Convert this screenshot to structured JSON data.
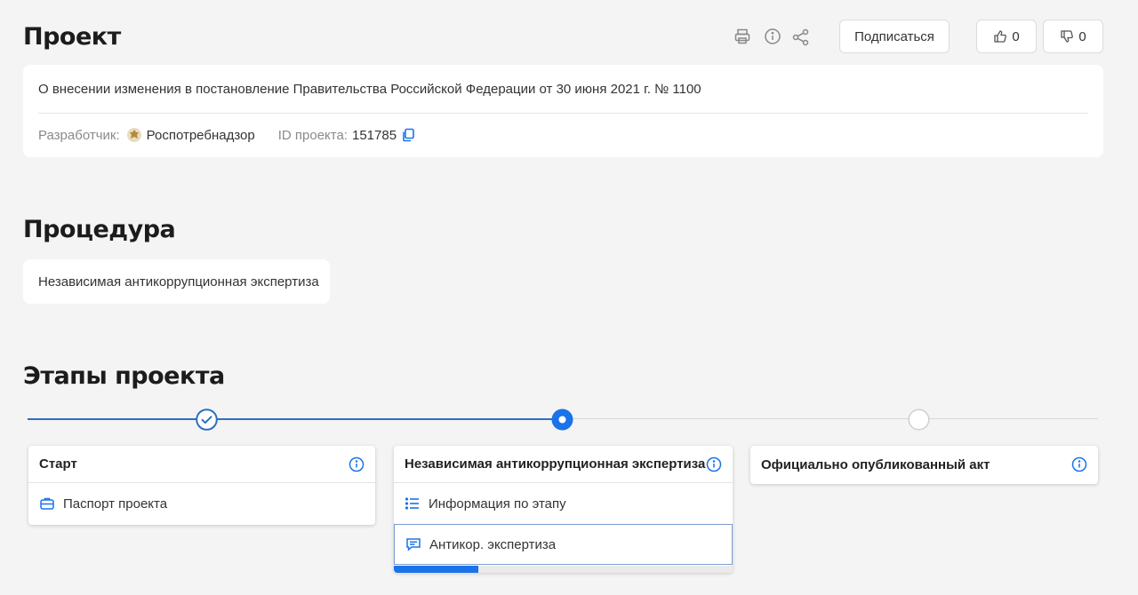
{
  "project": {
    "heading": "Проект",
    "subscribe_label": "Подписаться",
    "likes": "0",
    "dislikes": "0",
    "description": "О внесении изменения в постановление Правительства Российской Федерации от 30 июня 2021 г. № 1100",
    "developer_label": "Разработчик:",
    "developer_value": "Роспотребнадзор",
    "id_label": "ID проекта:",
    "id_value": "151785"
  },
  "procedure": {
    "heading": "Процедура",
    "value": "Независимая антикоррупционная экспертиза"
  },
  "stages": {
    "heading": "Этапы проекта",
    "items": [
      {
        "title": "Старт",
        "status": "done",
        "links": [
          {
            "label": "Паспорт проекта",
            "icon": "briefcase-icon"
          }
        ]
      },
      {
        "title": "Независимая антикоррупционная экспертиза",
        "status": "current",
        "progress": 0.25,
        "links": [
          {
            "label": "Информация по этапу",
            "icon": "list-icon"
          },
          {
            "label": "Антикор. экспертиза",
            "icon": "comment-icon"
          }
        ]
      },
      {
        "title": "Официально опубликованный акт",
        "status": "pending",
        "links": []
      }
    ]
  },
  "colors": {
    "accent": "#1a73e8",
    "timeline": "#2f6fc0",
    "background": "#f4f4f4"
  }
}
